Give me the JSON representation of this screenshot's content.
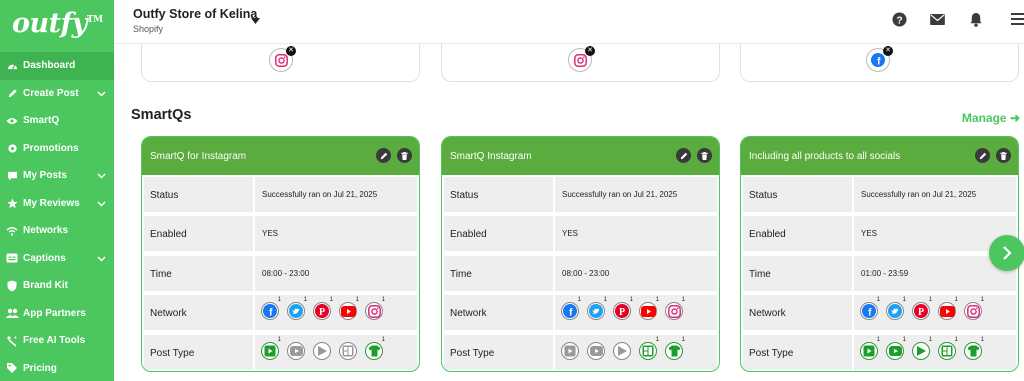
{
  "app": {
    "logo_text": "outfy",
    "logo_mark": "TM"
  },
  "sidebar": {
    "items": [
      {
        "label": "Dashboard",
        "icon": "dashboard-icon",
        "active": true,
        "has_submenu": false
      },
      {
        "label": "Create Post",
        "icon": "pencil-icon",
        "active": false,
        "has_submenu": true
      },
      {
        "label": "SmartQ",
        "icon": "eye-icon",
        "active": false,
        "has_submenu": false
      },
      {
        "label": "Promotions",
        "icon": "gear-icon",
        "active": false,
        "has_submenu": false
      },
      {
        "label": "My Posts",
        "icon": "chat-icon",
        "active": false,
        "has_submenu": true
      },
      {
        "label": "My Reviews",
        "icon": "star-icon",
        "active": false,
        "has_submenu": true
      },
      {
        "label": "Networks",
        "icon": "wifi-icon",
        "active": false,
        "has_submenu": false
      },
      {
        "label": "Captions",
        "icon": "caption-icon",
        "active": false,
        "has_submenu": true
      },
      {
        "label": "Brand Kit",
        "icon": "shield-icon",
        "active": false,
        "has_submenu": false
      },
      {
        "label": "App Partners",
        "icon": "people-icon",
        "active": false,
        "has_submenu": false
      },
      {
        "label": "Free AI Tools",
        "icon": "ai-icon",
        "active": false,
        "has_submenu": false
      },
      {
        "label": "Pricing",
        "icon": "tag-icon",
        "active": false,
        "has_submenu": false
      }
    ]
  },
  "header": {
    "store_name": "Outfy Store of Kelina",
    "store_platform": "Shopify",
    "icons": [
      "help-icon",
      "mail-icon",
      "bell-icon",
      "menu-icon"
    ]
  },
  "top_cards": [
    {
      "network_icon": "instagram-icon"
    },
    {
      "network_icon": "instagram-icon"
    },
    {
      "network_icon": "facebook-icon"
    }
  ],
  "smartqs": {
    "title": "SmartQs",
    "manage_label": "Manage",
    "row_labels": {
      "status": "Status",
      "enabled": "Enabled",
      "time": "Time",
      "network": "Network",
      "post_type": "Post Type"
    },
    "cards": [
      {
        "title": "SmartQ for Instagram",
        "status": "Successfully ran on Jul 21, 2025",
        "enabled": "YES",
        "time": "08:00 - 23:00",
        "networks": [
          {
            "icon": "facebook-icon",
            "count": "1"
          },
          {
            "icon": "twitter-icon",
            "count": "1"
          },
          {
            "icon": "pinterest-icon",
            "count": "1"
          },
          {
            "icon": "youtube-icon",
            "count": "1"
          },
          {
            "icon": "instagram-icon",
            "count": "1"
          }
        ],
        "post_types": [
          {
            "icon": "video-post-icon",
            "count": "1",
            "on": true
          },
          {
            "icon": "youtube-post-icon",
            "count": "",
            "on": false
          },
          {
            "icon": "play-post-icon",
            "count": "",
            "on": false
          },
          {
            "icon": "collage-post-icon",
            "count": "",
            "on": false
          },
          {
            "icon": "product-post-icon",
            "count": "1",
            "on": true
          }
        ]
      },
      {
        "title": "SmartQ Instagram",
        "status": "Successfully ran on Jul 21, 2025",
        "enabled": "YES",
        "time": "08:00 - 23:00",
        "networks": [
          {
            "icon": "facebook-icon",
            "count": "1"
          },
          {
            "icon": "twitter-icon",
            "count": "1"
          },
          {
            "icon": "pinterest-icon",
            "count": "1"
          },
          {
            "icon": "youtube-icon",
            "count": "1"
          },
          {
            "icon": "instagram-icon",
            "count": "1"
          }
        ],
        "post_types": [
          {
            "icon": "video-post-icon",
            "count": "",
            "on": false
          },
          {
            "icon": "youtube-post-icon",
            "count": "",
            "on": false
          },
          {
            "icon": "play-post-icon",
            "count": "",
            "on": false
          },
          {
            "icon": "collage-post-icon",
            "count": "1",
            "on": true
          },
          {
            "icon": "product-post-icon",
            "count": "1",
            "on": true
          }
        ]
      },
      {
        "title": "Including all products to all socials",
        "status": "Successfully ran on Jul 21, 2025",
        "enabled": "YES",
        "time": "01:00 - 23:59",
        "networks": [
          {
            "icon": "facebook-icon",
            "count": "1"
          },
          {
            "icon": "twitter-icon",
            "count": "1"
          },
          {
            "icon": "pinterest-icon",
            "count": "1"
          },
          {
            "icon": "youtube-icon",
            "count": "1"
          },
          {
            "icon": "instagram-icon",
            "count": "1"
          }
        ],
        "post_types": [
          {
            "icon": "video-post-icon",
            "count": "1",
            "on": true
          },
          {
            "icon": "youtube-post-icon",
            "count": "1",
            "on": true
          },
          {
            "icon": "play-post-icon",
            "count": "1",
            "on": true
          },
          {
            "icon": "collage-post-icon",
            "count": "1",
            "on": true
          },
          {
            "icon": "product-post-icon",
            "count": "1",
            "on": true
          }
        ]
      }
    ]
  },
  "colors": {
    "brand_green": "#4cc65e",
    "card_header_green": "#5aac3e"
  }
}
